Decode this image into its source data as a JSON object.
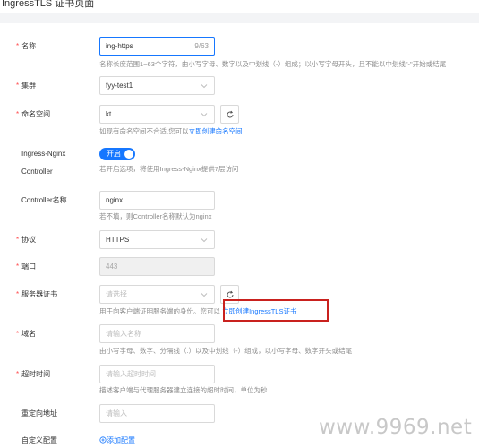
{
  "page_title": "IngressTLS 证书页面",
  "form": {
    "name": {
      "label": "名称",
      "value": "ing-https",
      "count": "9/63",
      "help": "名称长度范围1~63个字符，由小写字母、数字以及中划线（-）组成；以小写字母开头，且不能以中划线\"-\"开始或结尾"
    },
    "cluster": {
      "label": "集群",
      "value": "fyy-test1"
    },
    "namespace": {
      "label": "命名空间",
      "value": "kt",
      "help": "如现有命名空间不合适,您可以",
      "help_link": "立即创建命名空间"
    },
    "ingress_nginx": {
      "label_line1": "Ingress-Nginx",
      "label_line2": "Controller",
      "toggle_text": "开启",
      "help": "若开启选项，将使用Ingress-Nginx提供7层访问"
    },
    "controller_name": {
      "label": "Controller名称",
      "value": "nginx",
      "help": "若不填，则Controller名称默认为nginx"
    },
    "protocol": {
      "label": "协议",
      "value": "HTTPS"
    },
    "port": {
      "label": "端口",
      "value": "443"
    },
    "certificate": {
      "label": "服务器证书",
      "placeholder": "请选择",
      "help": "用于向客户端证明服务端的身份。您可以",
      "help_link": "立即创建IngressTLS证书"
    },
    "domain": {
      "label": "域名",
      "placeholder": "请输入名称",
      "help": "由小写字母、数字、分隔线（.）以及中划线（-）组成，以小写字母、数字开头或结尾"
    },
    "timeout": {
      "label": "超时时间",
      "placeholder": "请输入超时时间",
      "help": "描述客户端与代理服务器建立连接的超时时间，单位为秒"
    },
    "redirect": {
      "label": "重定向地址",
      "placeholder": "请输入"
    },
    "custom_config": {
      "label": "自定义配置",
      "add_label": "添加配置"
    }
  },
  "watermark": "www.9969.net",
  "colors": {
    "primary": "#1677ff",
    "required": "#ff4d4f",
    "highlight_box": "#c9211e"
  }
}
